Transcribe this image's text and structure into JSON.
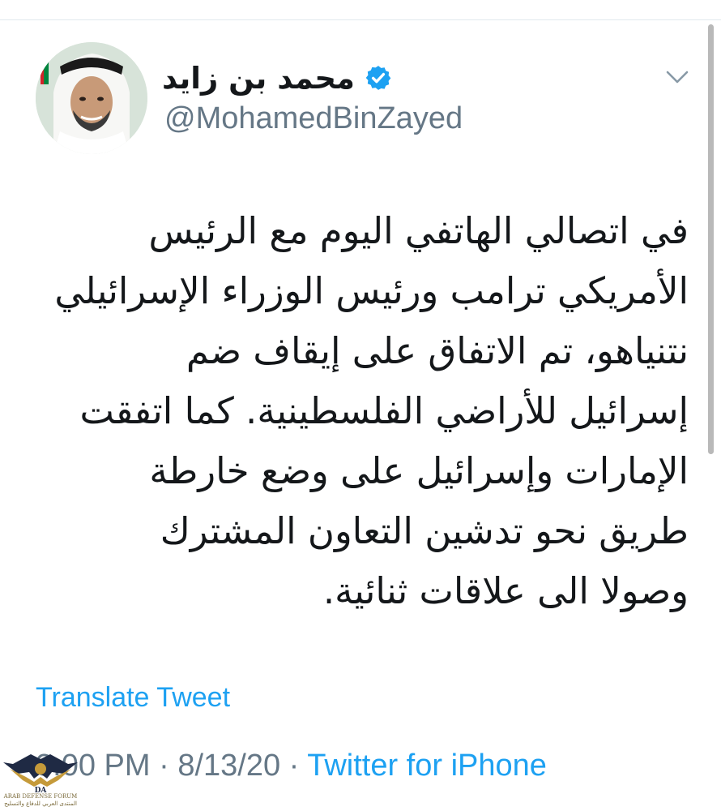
{
  "tweet": {
    "author": {
      "display_name": "محمد بن زايد",
      "handle": "@MohamedBinZayed",
      "verified": true
    },
    "lines": [
      "في اتصالي الهاتفي اليوم مع الرئيس",
      "الأمريكي ترامب ورئيس الوزراء الإسرائيلي",
      "نتنياهو، تم الاتفاق على إيقاف ضم",
      "إسرائيل للأراضي الفلسطينية. كما اتفقت",
      "الإمارات وإسرائيل على وضع خارطة",
      "طريق نحو تدشين التعاون المشترك",
      "وصولا الى علاقات ثنائية."
    ],
    "translate_label": "Translate Tweet",
    "time": "3:00 PM",
    "separator": "·",
    "date": "8/13/20",
    "source": "Twitter for iPhone"
  },
  "watermark": {
    "badge": "DA",
    "name": "ARAB DEFENSE FORUM",
    "tagline": "المنتدى العربي للدفاع والتسليح"
  },
  "colors": {
    "link": "#1da1f2",
    "secondary_text": "#657786",
    "primary_text": "#14171a",
    "verified": "#1da1f2"
  },
  "icons": {
    "verified": "verified-badge-icon",
    "menu": "chevron-down-icon"
  }
}
